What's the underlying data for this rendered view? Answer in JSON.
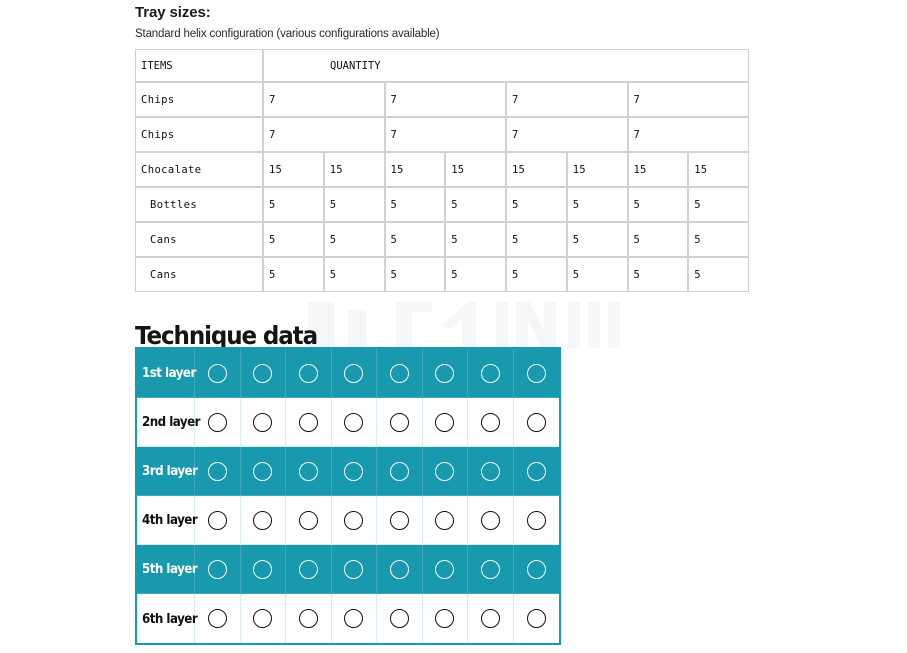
{
  "tray": {
    "title": "Tray sizes:",
    "subtitle": "Standard helix configuration (various configurations available)",
    "headers": {
      "items": "ITEMS",
      "quantity": "QUANTITY"
    },
    "rows": [
      {
        "label": "Chips",
        "indent": false,
        "values": [
          "7",
          "7",
          "7",
          "7"
        ]
      },
      {
        "label": "Chips",
        "indent": false,
        "values": [
          "7",
          "7",
          "7",
          "7"
        ]
      },
      {
        "label": "Chocalate",
        "indent": false,
        "values": [
          "15",
          "15",
          "15",
          "15",
          "15",
          "15",
          "15",
          "15"
        ]
      },
      {
        "label": "Bottles",
        "indent": true,
        "values": [
          "5",
          "5",
          "5",
          "5",
          "5",
          "5",
          "5",
          "5"
        ]
      },
      {
        "label": "Cans",
        "indent": true,
        "values": [
          "5",
          "5",
          "5",
          "5",
          "5",
          "5",
          "5",
          "5"
        ]
      },
      {
        "label": "Cans",
        "indent": true,
        "values": [
          "5",
          "5",
          "5",
          "5",
          "5",
          "5",
          "5",
          "5"
        ]
      }
    ]
  },
  "technique": {
    "title": "Technique data",
    "columns": 8,
    "colors": {
      "teal": "#1899ad",
      "teal_border": "#159cb0",
      "grid_line": "#d8eef1"
    },
    "rows": [
      {
        "label": "1st layer",
        "style": "teal",
        "holes": 8
      },
      {
        "label": "2nd layer",
        "style": "plain",
        "holes": 8
      },
      {
        "label": "3rd layer",
        "style": "teal",
        "holes": 8
      },
      {
        "label": "4th layer",
        "style": "plain",
        "holes": 8
      },
      {
        "label": "5th layer",
        "style": "teal",
        "holes": 8
      },
      {
        "label": "6th layer",
        "style": "plain",
        "holes": 8
      }
    ]
  }
}
